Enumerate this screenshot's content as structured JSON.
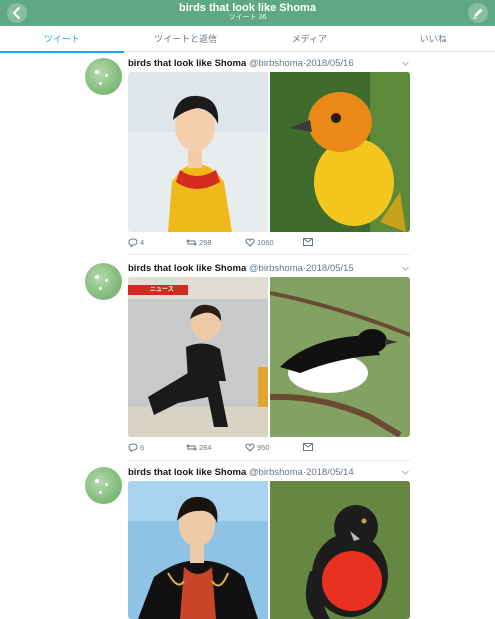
{
  "header": {
    "title": "birds that look like Shoma",
    "subtitle": "ツイート 36",
    "bg_color": "#5ea883"
  },
  "tabs": [
    {
      "label": "ツイート",
      "active": true
    },
    {
      "label": "ツイートと返信",
      "active": false
    },
    {
      "label": "メディア",
      "active": false
    },
    {
      "label": "いいね",
      "active": false
    }
  ],
  "accent_color": "#1da1f2",
  "tweets": [
    {
      "name": "birds that look like Shoma",
      "handle": "@birbshoma",
      "date": "2018/05/16",
      "replies": "4",
      "retweets": "298",
      "likes": "1060"
    },
    {
      "name": "birds that look like Shoma",
      "handle": "@birbshoma",
      "date": "2018/05/15",
      "replies": "6",
      "retweets": "284",
      "likes": "950",
      "photo_caption": "ニュース"
    },
    {
      "name": "birds that look like Shoma",
      "handle": "@birbshoma",
      "date": "2018/05/14"
    }
  ],
  "icons": {
    "back": "chevron-left-icon",
    "compose": "compose-icon",
    "reply": "reply-icon",
    "retweet": "retweet-icon",
    "like": "heart-icon",
    "dm": "envelope-icon",
    "caret": "chevron-down-icon"
  }
}
